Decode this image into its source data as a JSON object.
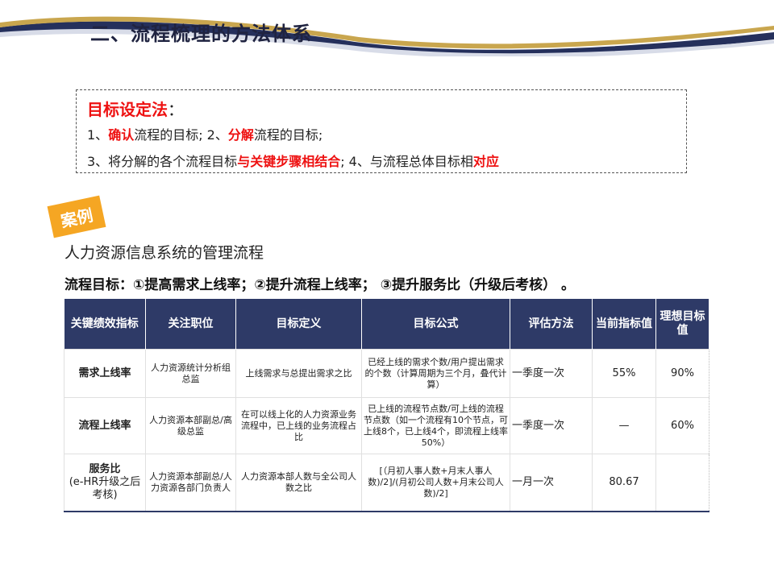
{
  "title": "二、流程梳理的方法体系",
  "method_box": {
    "title": "目标设定法",
    "colon": "：",
    "line1": [
      "1、",
      "确认",
      "流程的目标; 2、",
      "分解",
      "流程的目标;"
    ],
    "line2": [
      "3、将分解的各个流程目标",
      "与关键步骤相结合",
      "; 4、与流程总体目标相",
      "对应"
    ]
  },
  "badge": "案例",
  "case_title": "人力资源信息系统的管理流程",
  "goal_line": "流程目标：①提高需求上线率；②提升流程上线率；  ③提升服务比（升级后考核）  。",
  "table": {
    "headers": [
      "关键绩效指标",
      "关注职位",
      "目标定义",
      "目标公式",
      "评估方法",
      "当前指标值",
      "理想目标值"
    ],
    "rows": [
      {
        "name": "需求上线率",
        "name_sub": "",
        "position": "人力资源统计分析组总监",
        "definition": "上线需求与总提出需求之比",
        "formula": "已经上线的需求个数/用户提出需求的个数（计算周期为三个月，叠代计算）",
        "method": "一季度一次",
        "current": "55%",
        "ideal": "90%"
      },
      {
        "name": "流程上线率",
        "name_sub": "",
        "position": "人力资源本部副总/高级总监",
        "definition": "在可以线上化的人力资源业务流程中，已上线的业务流程占比",
        "formula": "已上线的流程节点数/可上线的流程节点数（如一个流程有10个节点，可上线8个，已上线4个，即流程上线率50%）",
        "method": "一季度一次",
        "current": "—",
        "ideal": "60%"
      },
      {
        "name": "服务比",
        "name_sub": "(e-HR升级之后考核)",
        "position": "人力资源本部副总/人力资源各部门负责人",
        "definition": "人力资源本部人数与全公司人数之比",
        "formula": "[（月初人事人数+月末人事人数)/2]/(月初公司人数+月末公司人数)/2]",
        "method": "一月一次",
        "current": "80.67",
        "ideal": ""
      }
    ]
  }
}
